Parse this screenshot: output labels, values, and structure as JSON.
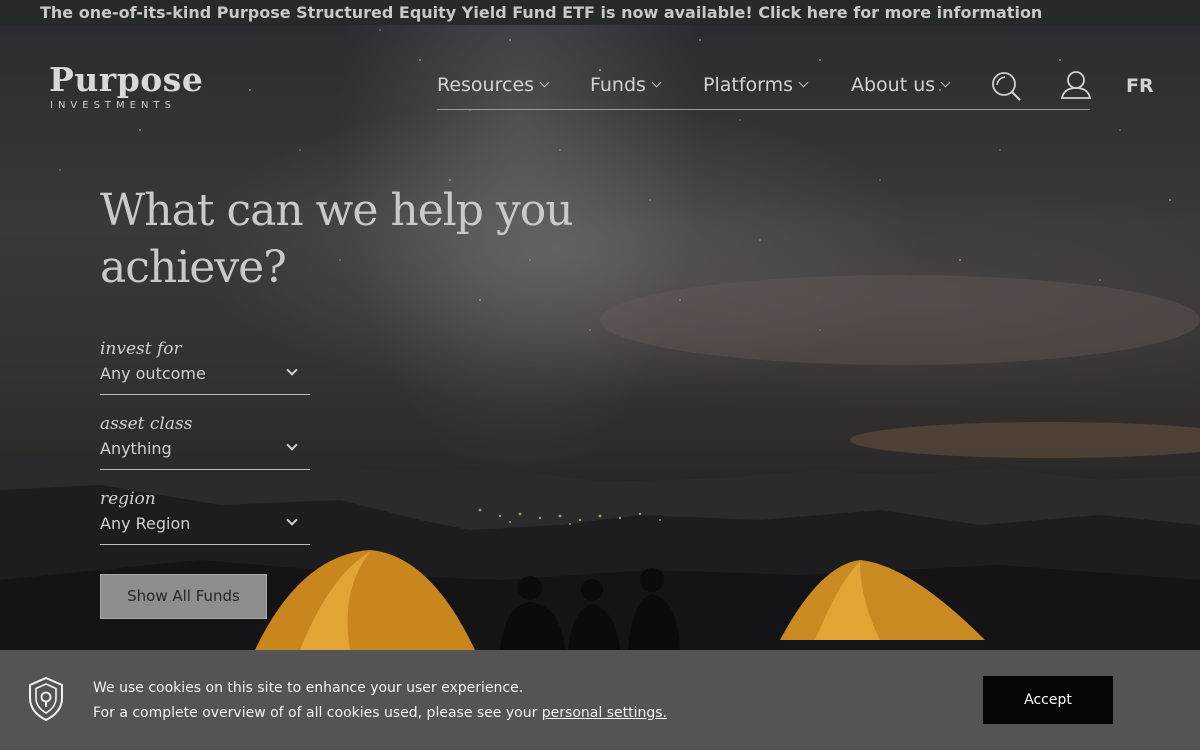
{
  "announcement": {
    "text": "The one-of-its-kind Purpose Structured Equity Yield Fund ETF is now available! Click here for more information"
  },
  "header": {
    "logo_word": "Purpose",
    "logo_sub": "INVESTMENTS",
    "nav": [
      {
        "label": "Resources"
      },
      {
        "label": "Funds"
      },
      {
        "label": "Platforms"
      },
      {
        "label": "About us"
      }
    ],
    "lang_label": "FR",
    "icons": [
      "search-icon",
      "user-icon"
    ]
  },
  "hero": {
    "headline_line1": "What can we help you",
    "headline_line2": "achieve?",
    "filters": [
      {
        "label": "invest for",
        "value": "Any outcome"
      },
      {
        "label": "asset class",
        "value": "Anything"
      },
      {
        "label": "region",
        "value": "Any Region"
      }
    ],
    "show_all_label": "Show All Funds"
  },
  "cookie": {
    "line1": "We use cookies on this site to enhance your user experience.",
    "line2_prefix": "For a complete overview of of all cookies used, please see your ",
    "link_text": "personal settings.",
    "accept_label": "Accept"
  },
  "colors": {
    "announcement_bg": "#262b2a",
    "cookie_bg": "#545454",
    "accept_bg": "#050505",
    "tent_glow": "#e8a42a"
  }
}
